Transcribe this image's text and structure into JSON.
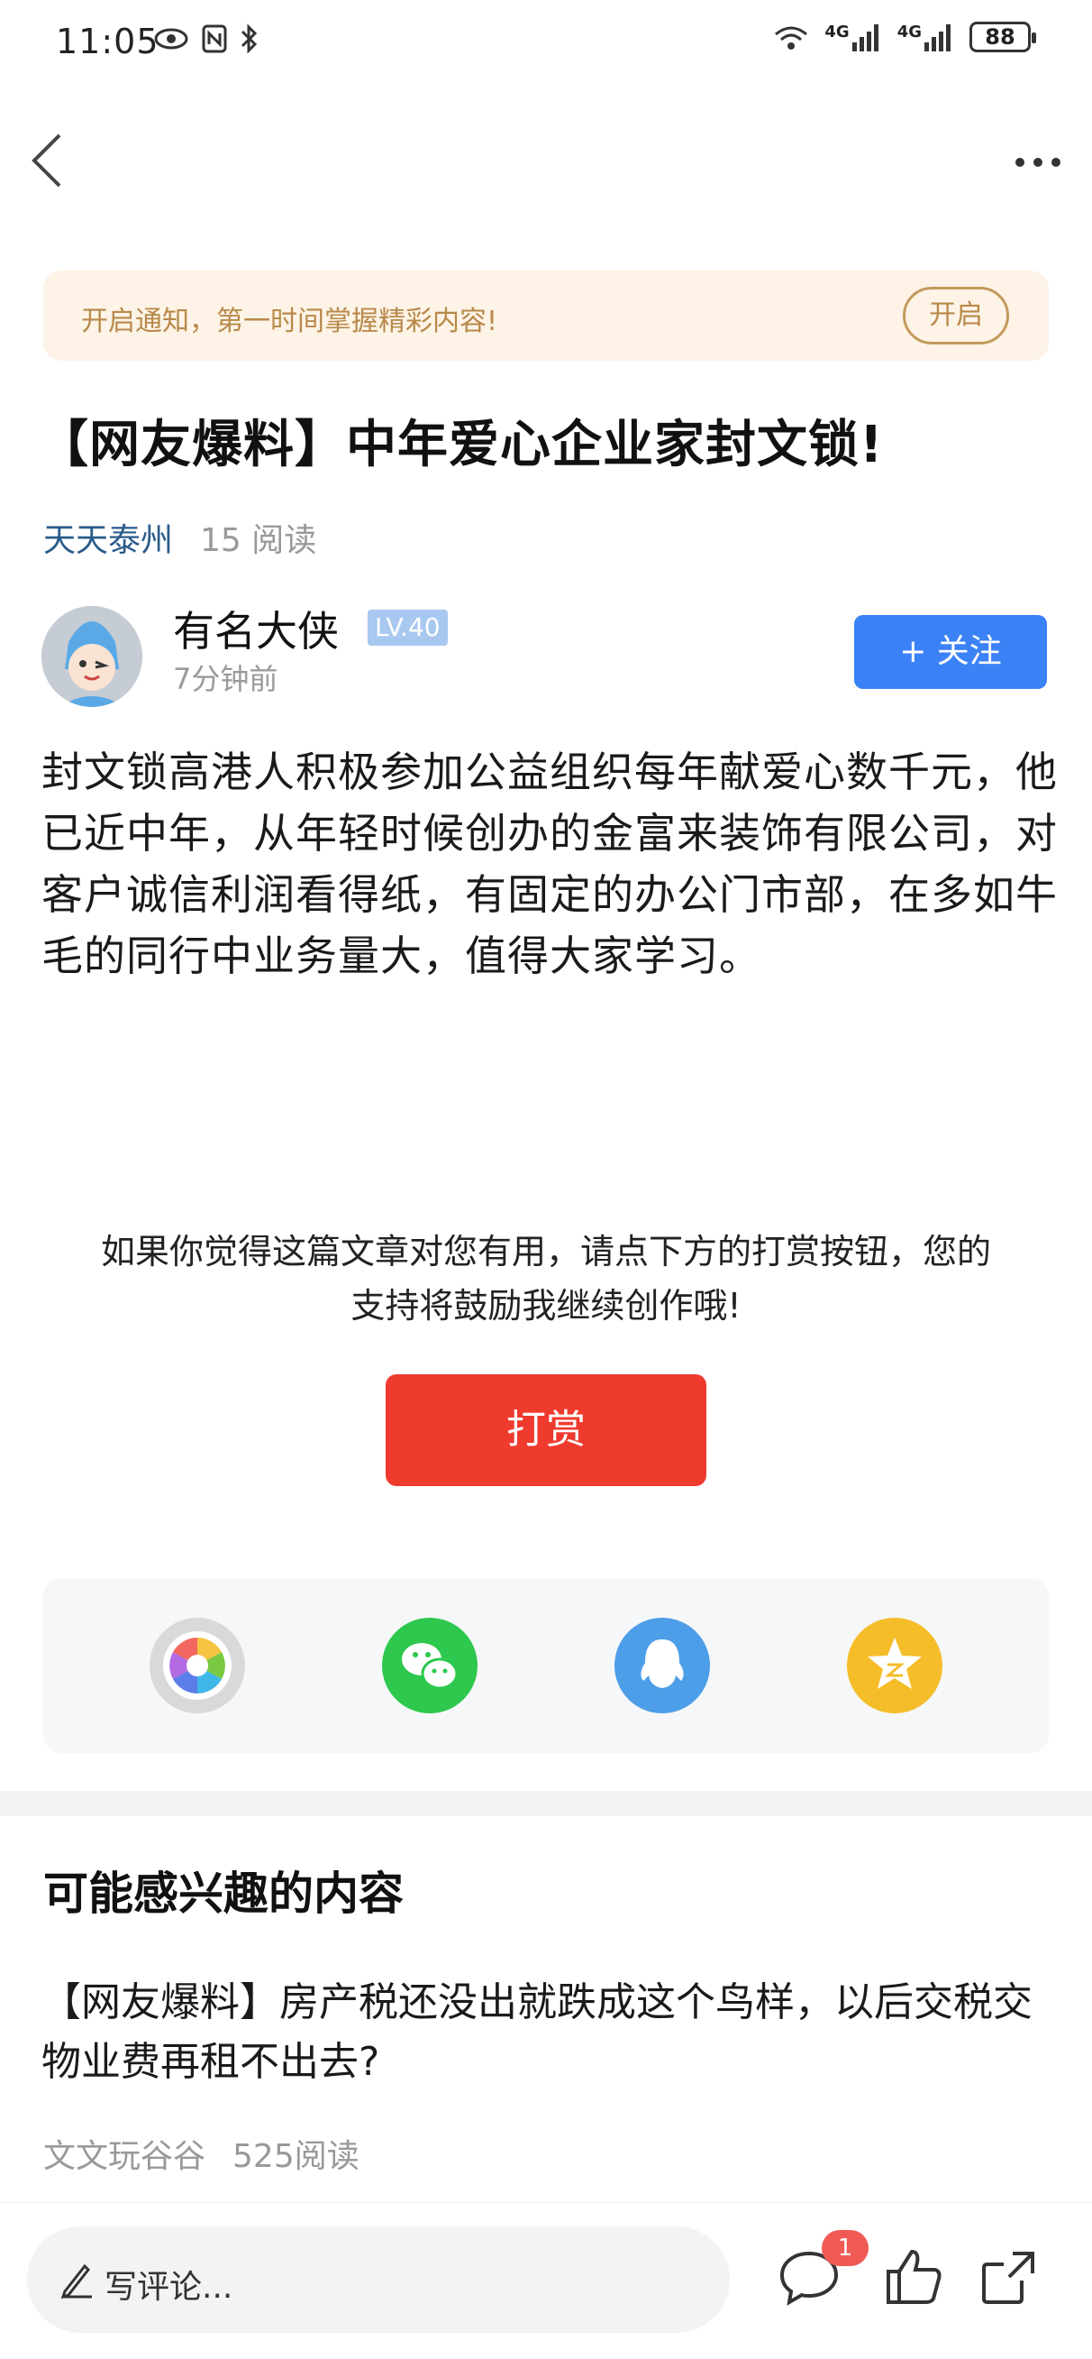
{
  "status_bar": {
    "time": "11:05",
    "battery": "88",
    "network_1": "4G",
    "network_2": "4G"
  },
  "notify": {
    "text": "开启通知，第一时间掌握精彩内容!",
    "button": "开启"
  },
  "article": {
    "title": "【网友爆料】中年爱心企业家封文锁!",
    "source": "天天泰州",
    "reads": "15 阅读",
    "body": "封文锁高港人积极参加公益组织每年献爱心数千元，他已近中年，从年轻时候创办的金富来装饰有限公司，对客户诚信利润看得纸，有固定的办公门市部，在多如牛毛的同行中业务量大，值得大家学习。"
  },
  "author": {
    "name": "有名大侠",
    "level": "LV.40",
    "time": "7分钟前",
    "follow_label": "+ 关注"
  },
  "reward": {
    "text": "如果你觉得这篇文章对您有用，请点下方的打赏按钮，您的支持将鼓励我继续创作哦!",
    "button": "打赏"
  },
  "share": {
    "items": [
      "moments-icon",
      "wechat-icon",
      "qq-icon",
      "qzone-icon"
    ]
  },
  "recommend": {
    "section_title": "可能感兴趣的内容",
    "items": [
      {
        "title": "【网友爆料】房产税还没出就跌成这个鸟样，以后交税交物业费再租不出去?",
        "source": "文文玩谷谷",
        "reads": "525阅读"
      }
    ]
  },
  "bottom_bar": {
    "comment_placeholder": "写评论...",
    "comment_count": "1"
  },
  "colors": {
    "accent_blue": "#3b82f6",
    "reward_red": "#ee3b2e",
    "notify_bg": "#fdf3e6",
    "source_blue": "#2a5b8a"
  }
}
